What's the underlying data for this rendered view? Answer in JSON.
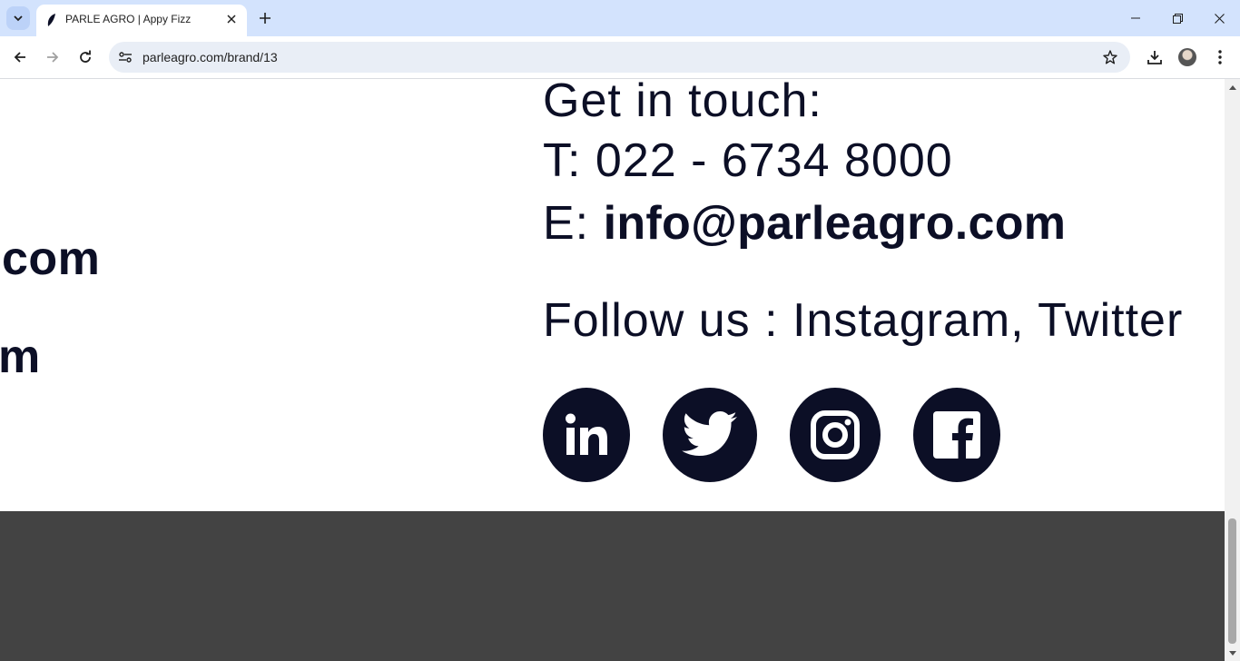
{
  "browser": {
    "tab": {
      "title": "PARLE AGRO | Appy Fizz",
      "favicon": "leaf-icon"
    },
    "url": "parleagro.com/brand/13"
  },
  "page": {
    "left_fragments": [
      "com",
      "m"
    ],
    "contact": {
      "heading": "Get in touch:",
      "phone_prefix": "T:",
      "phone": "022 - 6734 8000",
      "email_prefix": "E:",
      "email": "info@parleagro.com",
      "follow": "Follow us : Instagram, Twitter"
    },
    "social_icons": [
      "linkedin-icon",
      "twitter-icon",
      "instagram-icon",
      "facebook-icon"
    ],
    "colors": {
      "text": "#0c0f26",
      "footer": "#434343",
      "tabbar": "#d3e3fd"
    }
  }
}
